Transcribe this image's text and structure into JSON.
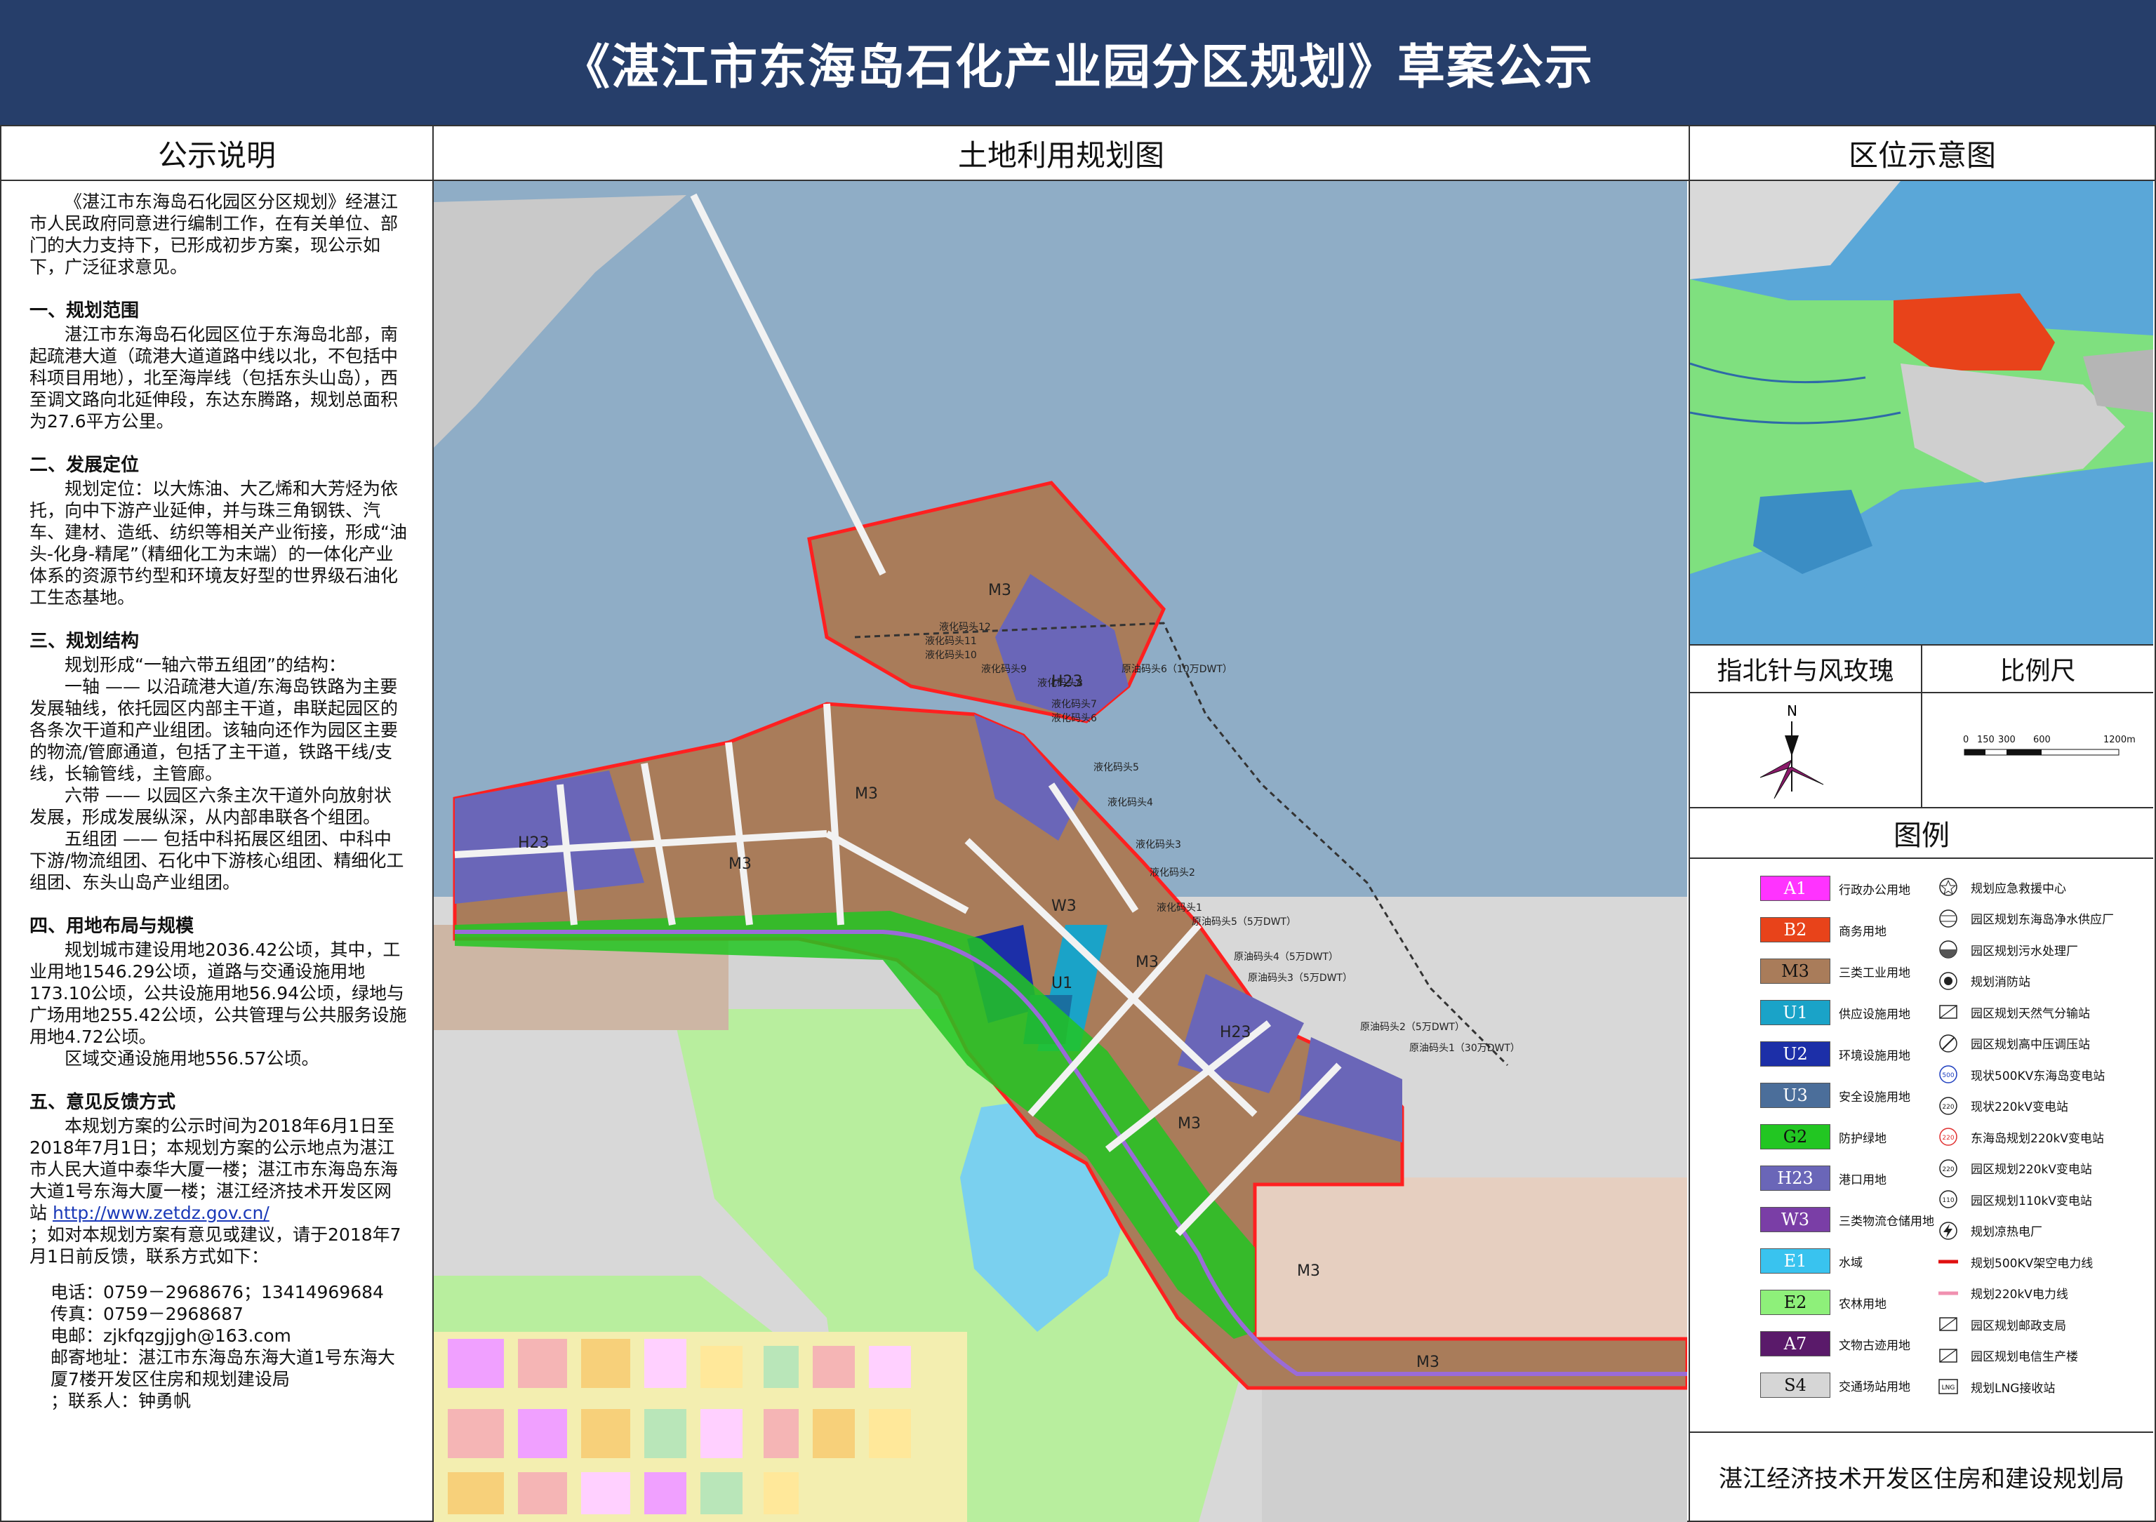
{
  "title": "《湛江市东海岛石化产业园分区规划》草案公示",
  "left": {
    "heading": "公示说明",
    "intro": "《湛江市东海岛石化园区分区规划》经湛江市人民政府同意进行编制工作，在有关单位、部门的大力支持下，已形成初步方案，现公示如下，广泛征求意见。",
    "s1_title": "一、规划范围",
    "s1_body": "湛江市东海岛石化园区位于东海岛北部，南起疏港大道（疏港大道道路中线以北，不包括中科项目用地），北至海岸线（包括东头山岛），西至调文路向北延伸段，东达东腾路，规划总面积为27.6平方公里。",
    "s2_title": "二、发展定位",
    "s2_body": "规划定位：以大炼油、大乙烯和大芳烃为依托，向中下游产业延伸，并与珠三角钢铁、汽车、建材、造纸、纺织等相关产业衔接，形成“油头-化身-精尾”（精细化工为末端）的一体化产业体系的资源节约型和环境友好型的世界级石油化工生态基地。",
    "s3_title": "三、规划结构",
    "s3_p1": "规划形成“一轴六带五组团”的结构：",
    "s3_p2": "一轴 —— 以沿疏港大道/东海岛铁路为主要发展轴线，依托园区内部主干道，串联起园区的各条次干道和产业组团。该轴向还作为园区主要的物流/管廊通道，包括了主干道，铁路干线/支线，长输管线，主管廊。",
    "s3_p3": "六带 —— 以园区六条主次干道外向放射状发展，形成发展纵深，从内部串联各个组团。",
    "s3_p4": "五组团 —— 包括中科拓展区组团、中科中下游/物流组团、石化中下游核心组团、精细化工组团、东头山岛产业组团。",
    "s4_title": "四、用地布局与规模",
    "s4_p1": "规划城市建设用地2036.42公顷，其中，工业用地1546.29公顷，道路与交通设施用地173.10公顷，公共设施用地56.94公顷，绿地与广场用地255.42公顷，公共管理与公共服务设施用地4.72公顷。",
    "s4_p2": "区域交通设施用地556.57公顷。",
    "s5_title": "五、意见反馈方式",
    "s5_p1": "本规划方案的公示时间为2018年6月1日至2018年7月1日；本规划方案的公示地点为湛江市人民大道中泰华大厦一楼；湛江市东海岛东海大道1号东海大厦一楼；湛江经济技术开发区网站",
    "s5_link": "http://www.zetdz.gov.cn/",
    "s5_p2": "；如对本规划方案有意见或建议，请于2018年7月1日前反馈，联系方式如下：",
    "contact_phone": "电话：0759－2968676；13414969684",
    "contact_fax": "传真：0759－2968687",
    "contact_email": "电邮：zjkfqzgjjgh@163.com",
    "contact_address": "邮寄地址：湛江市东海岛东海大道1号东海大厦7楼开发区住房和规划建设局",
    "contact_person": "；联系人：钟勇帆"
  },
  "center": {
    "heading": "土地利用规划图",
    "zone_labels": [
      "M3",
      "M3",
      "M3",
      "H23",
      "H23",
      "H23",
      "M3",
      "M3",
      "M3",
      "W3",
      "U1",
      "M3"
    ],
    "wharf_labels": [
      "液化码头12",
      "液化码头11",
      "液化码头10",
      "液化码头9",
      "液化码头8",
      "液化码头7",
      "液化码头6",
      "液化码头5",
      "液化码头4",
      "液化码头3",
      "液化码头2",
      "液化码头1",
      "原油码头6（10万DWT）",
      "原油码头5（5万DWT）",
      "原油码头4（5万DWT）",
      "原油码头3（5万DWT）",
      "原油码头2（5万DWT）",
      "原油码头1（30万DWT）"
    ]
  },
  "right": {
    "heading": "区位示意图",
    "compass_heading": "指北针与风玫瑰",
    "north_label": "N",
    "scale_heading": "比例尺",
    "scale_ticks": [
      "0",
      "150",
      "300",
      "600",
      "1200m"
    ],
    "legend_heading": "图例",
    "land_uses": [
      {
        "code": "A1",
        "label": "行政办公用地",
        "color": "#ff33ff",
        "text_color": "#ffffff"
      },
      {
        "code": "B2",
        "label": "商务用地",
        "color": "#e8431a",
        "text_color": "#ffffff"
      },
      {
        "code": "M3",
        "label": "三类工业用地",
        "color": "#a97c5a",
        "text_color": "#111111"
      },
      {
        "code": "U1",
        "label": "供应设施用地",
        "color": "#1aa3c8",
        "text_color": "#ffffff"
      },
      {
        "code": "U2",
        "label": "环境设施用地",
        "color": "#1c2fa8",
        "text_color": "#ffffff"
      },
      {
        "code": "U3",
        "label": "安全设施用地",
        "color": "#4b6e9a",
        "text_color": "#ffffff"
      },
      {
        "code": "G2",
        "label": "防护绿地",
        "color": "#22c622",
        "text_color": "#111111"
      },
      {
        "code": "H23",
        "label": "港口用地",
        "color": "#6a66b8",
        "text_color": "#ffffff"
      },
      {
        "code": "W3",
        "label": "三类物流仓储用地",
        "color": "#7a3ea6",
        "text_color": "#ffffff"
      },
      {
        "code": "E1",
        "label": "水域",
        "color": "#39c3ef",
        "text_color": "#ffffff"
      },
      {
        "code": "E2",
        "label": "农林用地",
        "color": "#8ef07a",
        "text_color": "#111111"
      },
      {
        "code": "A7",
        "label": "文物古迹用地",
        "color": "#5a1a6a",
        "text_color": "#ffffff"
      },
      {
        "code": "S4",
        "label": "交通场站用地",
        "color": "#d6d6d6",
        "text_color": "#111111"
      }
    ],
    "facilities": [
      {
        "symbol": "star",
        "label": "规划应急救援中心"
      },
      {
        "symbol": "circle-lines",
        "label": "园区规划东海岛净水供应厂"
      },
      {
        "symbol": "circle-half",
        "label": "园区规划污水处理厂"
      },
      {
        "symbol": "circle-dot",
        "label": "规划消防站"
      },
      {
        "symbol": "hatch-box",
        "label": "园区规划天然气分输站"
      },
      {
        "symbol": "circle-split",
        "label": "园区规划高中压调压站"
      },
      {
        "symbol": "500",
        "label": "现状500KV东海岛变电站"
      },
      {
        "symbol": "220",
        "label": "现状220kV变电站"
      },
      {
        "symbol": "220r",
        "label": "东海岛规划220kV变电站"
      },
      {
        "symbol": "220",
        "label": "园区规划220kV变电站"
      },
      {
        "symbol": "110",
        "label": "园区规划110kV变电站"
      },
      {
        "symbol": "bolt",
        "label": "规划凉热电厂"
      },
      {
        "symbol": "line-red",
        "label": "规划500KV架空电力线"
      },
      {
        "symbol": "line-pink",
        "label": "规划220kV电力线"
      },
      {
        "symbol": "mail",
        "label": "园区规划邮政支局"
      },
      {
        "symbol": "box-lines",
        "label": "园区规划电信生产楼"
      },
      {
        "symbol": "LNG",
        "label": "规划LNG接收站"
      }
    ],
    "footer": "湛江经济技术开发区住房和建设规划局"
  }
}
